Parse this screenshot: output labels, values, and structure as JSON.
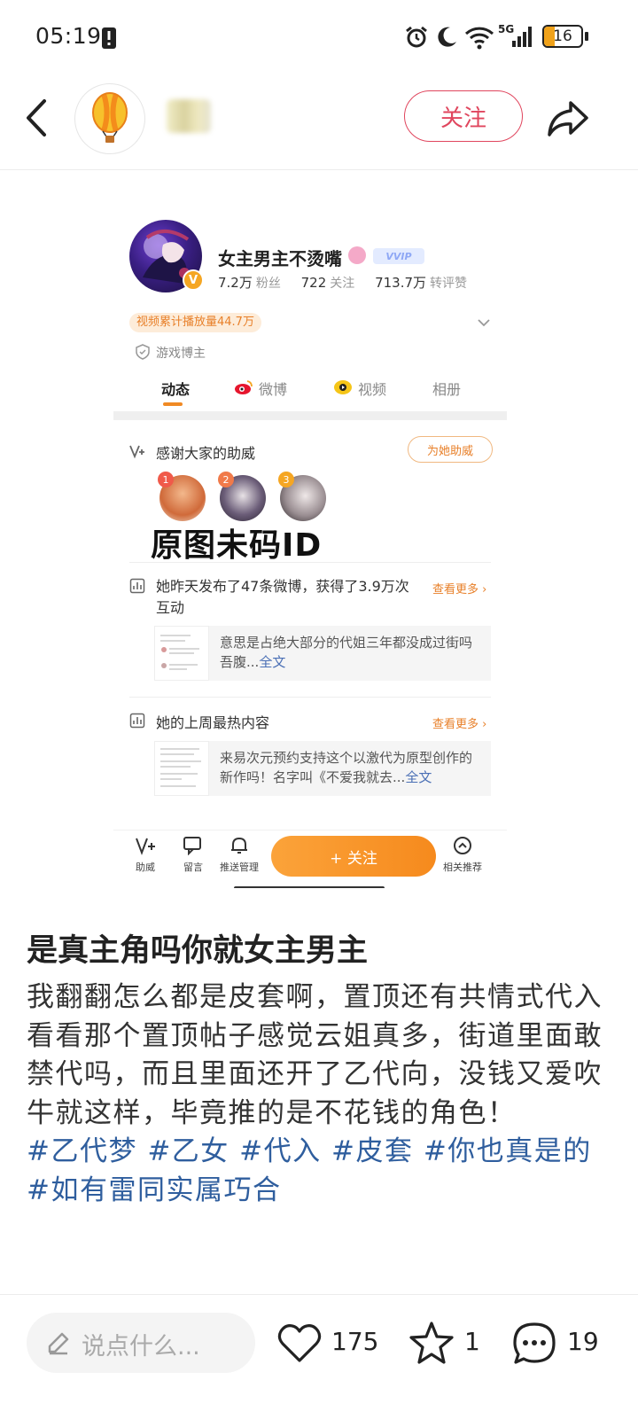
{
  "status_bar": {
    "time": "05:19",
    "network": "5G",
    "battery": "16"
  },
  "header": {
    "follow_label": "关注"
  },
  "embedded": {
    "profile_name": "女主男主不烫嘴",
    "vip_label": "VVIP",
    "avatar_badge": "V",
    "stats": [
      {
        "value": "7.2万",
        "label": "粉丝"
      },
      {
        "value": "722",
        "label": "关注"
      },
      {
        "value": "713.7万",
        "label": "转评赞"
      }
    ],
    "video_plays": "视频累计播放量44.7万",
    "category": "游戏博主",
    "tabs": [
      {
        "label": "动态",
        "active": true
      },
      {
        "label": "微博",
        "active": false
      },
      {
        "label": "视频",
        "active": false
      },
      {
        "label": "相册",
        "active": false
      }
    ],
    "thanks_title": "感谢大家的助威",
    "help_button": "为她助威",
    "fan_ranks": [
      "1",
      "2",
      "3"
    ],
    "overlay_text": "原图未码ID",
    "yesterday": {
      "title": "她昨天发布了47条微博，获得了3.9万次互动",
      "more": "查看更多",
      "excerpt": "意思是占绝大部分的代姐三年都没成过街吗 吾腹...",
      "link": "全文"
    },
    "last_week": {
      "title": "她的上周最热内容",
      "more": "查看更多",
      "excerpt": "来易次元预约支持这个以激代为原型创作的新作吗！名字叫《不爱我就去...",
      "link": "全文"
    },
    "bottom_nav": [
      {
        "label": "助威",
        "icon": "cheer-icon"
      },
      {
        "label": "留言",
        "icon": "message-icon"
      },
      {
        "label": "推送管理",
        "icon": "bell-icon"
      }
    ],
    "follow_big": "+ 关注",
    "related": "相关推荐"
  },
  "post": {
    "title": "是真主角吗你就女主男主",
    "body_line1": "我翻翻怎么都是皮套啊，置顶还有共情式代入",
    "body_line2": "看看那个置顶帖子感觉云姐真多，街道里面敢禁代吗，而且里面还开了乙代向，没钱又爱吹牛就这样，毕竟推的是不花钱的角色！",
    "tags": "#乙代梦 #乙女 #代入 #皮套 #你也真是的 #如有雷同实属巧合"
  },
  "bottom_bar": {
    "comment_placeholder": "说点什么...",
    "likes": "175",
    "favorites": "1",
    "comments": "19"
  }
}
